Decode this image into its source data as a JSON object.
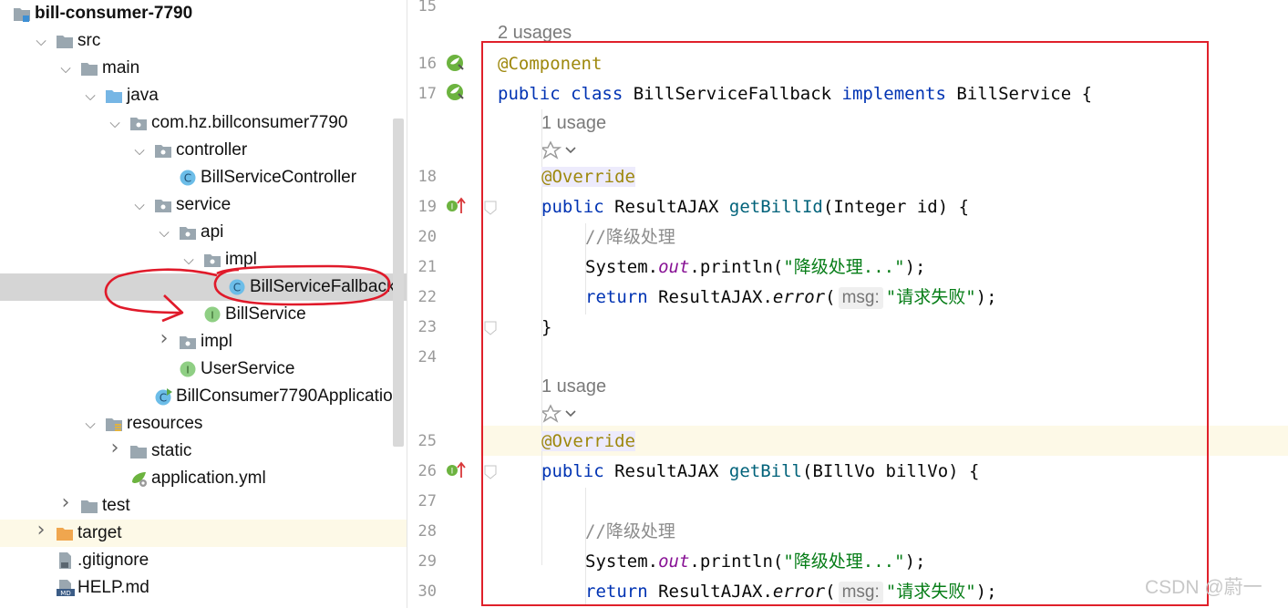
{
  "tree": {
    "items": [
      {
        "label": "bill-consumer-7790",
        "icon": "module-folder-icon",
        "arrow": "",
        "bold": true
      },
      {
        "label": "src",
        "icon": "folder-icon",
        "arrow": "chevron-down"
      },
      {
        "label": "main",
        "icon": "folder-icon",
        "arrow": "chevron-down"
      },
      {
        "label": "java",
        "icon": "source-folder-icon",
        "arrow": "chevron-down"
      },
      {
        "label": "com.hz.billconsumer7790",
        "icon": "package-icon",
        "arrow": "chevron-down"
      },
      {
        "label": "controller",
        "icon": "package-icon",
        "arrow": "chevron-down"
      },
      {
        "label": "BillServiceController",
        "icon": "class-icon",
        "arrow": ""
      },
      {
        "label": "service",
        "icon": "package-icon",
        "arrow": "chevron-down"
      },
      {
        "label": "api",
        "icon": "package-icon",
        "arrow": "chevron-down"
      },
      {
        "label": "impl",
        "icon": "package-icon",
        "arrow": "chevron-down"
      },
      {
        "label": "BillServiceFallback",
        "icon": "class-icon",
        "arrow": "",
        "selected": true
      },
      {
        "label": "BillService",
        "icon": "interface-icon",
        "arrow": ""
      },
      {
        "label": "impl",
        "icon": "package-icon",
        "arrow": "chevron-right"
      },
      {
        "label": "UserService",
        "icon": "interface-icon",
        "arrow": ""
      },
      {
        "label": "BillConsumer7790Applicatio",
        "icon": "spring-boot-class-icon",
        "arrow": ""
      },
      {
        "label": "resources",
        "icon": "resources-folder-icon",
        "arrow": "chevron-down"
      },
      {
        "label": "static",
        "icon": "folder-icon",
        "arrow": "chevron-right"
      },
      {
        "label": "application.yml",
        "icon": "yaml-config-icon",
        "arrow": ""
      },
      {
        "label": "test",
        "icon": "folder-icon",
        "arrow": "chevron-right"
      },
      {
        "label": "target",
        "icon": "excluded-folder-icon",
        "arrow": "chevron-right",
        "highlight": true
      },
      {
        "label": ".gitignore",
        "icon": "gitignore-file-icon",
        "arrow": ""
      },
      {
        "label": "HELP.md",
        "icon": "markdown-file-icon",
        "arrow": ""
      }
    ]
  },
  "editor": {
    "line_numbers": [
      "15",
      "16",
      "17",
      "18",
      "19",
      "20",
      "21",
      "22",
      "23",
      "24",
      "25",
      "26",
      "27",
      "28",
      "29",
      "30"
    ],
    "usages_2": "2 usages",
    "usages_1a": "1 usage",
    "usages_1b": "1 usage",
    "code": {
      "l16_ann": "@Component",
      "l17_kw1": "public",
      "l17_kw2": "class",
      "l17_name": " BillServiceFallback ",
      "l17_kw3": "implements",
      "l17_rest": " BillService {",
      "l18_ann": "@Override",
      "l19_kw": "public",
      "l19_type": " ResultAJAX ",
      "l19_meth": "getBillId",
      "l19_rest": "(Integer id) {",
      "l20_cmt": "//降级处理",
      "l21_a": "System.",
      "l21_fld": "out",
      "l21_b": ".println(",
      "l21_str": "\"降级处理...\"",
      "l21_c": ");",
      "l22_kw": "return",
      "l22_a": " ResultAJAX.",
      "l22_ital": "error",
      "l22_b": "(",
      "l22_hint": "msg:",
      "l22_str": "\"请求失败\"",
      "l22_c": ");",
      "l23": "}",
      "l25_ann": "@Override",
      "l26_kw": "public",
      "l26_type": " ResultAJAX ",
      "l26_meth": "getBill",
      "l26_rest": "(BIllVo billVo) {",
      "l28_cmt": "//降级处理",
      "l29_a": "System.",
      "l29_fld": "out",
      "l29_b": ".println(",
      "l29_str": "\"降级处理...\"",
      "l29_c": ");",
      "l30_kw": "return",
      "l30_a": " ResultAJAX.",
      "l30_ital": "error",
      "l30_b": "(",
      "l30_hint": "msg:",
      "l30_str": "\"请求失败\"",
      "l30_c": ");"
    }
  },
  "watermark": "CSDN @蔚一",
  "colors": {
    "keyword": "#0033b3",
    "annotation": "#9e880d",
    "method": "#00627a",
    "string": "#067d17",
    "field": "#871094",
    "comment": "#8c8c8c",
    "annotation_box": "#e0202a",
    "selection": "#d5d5d5"
  }
}
